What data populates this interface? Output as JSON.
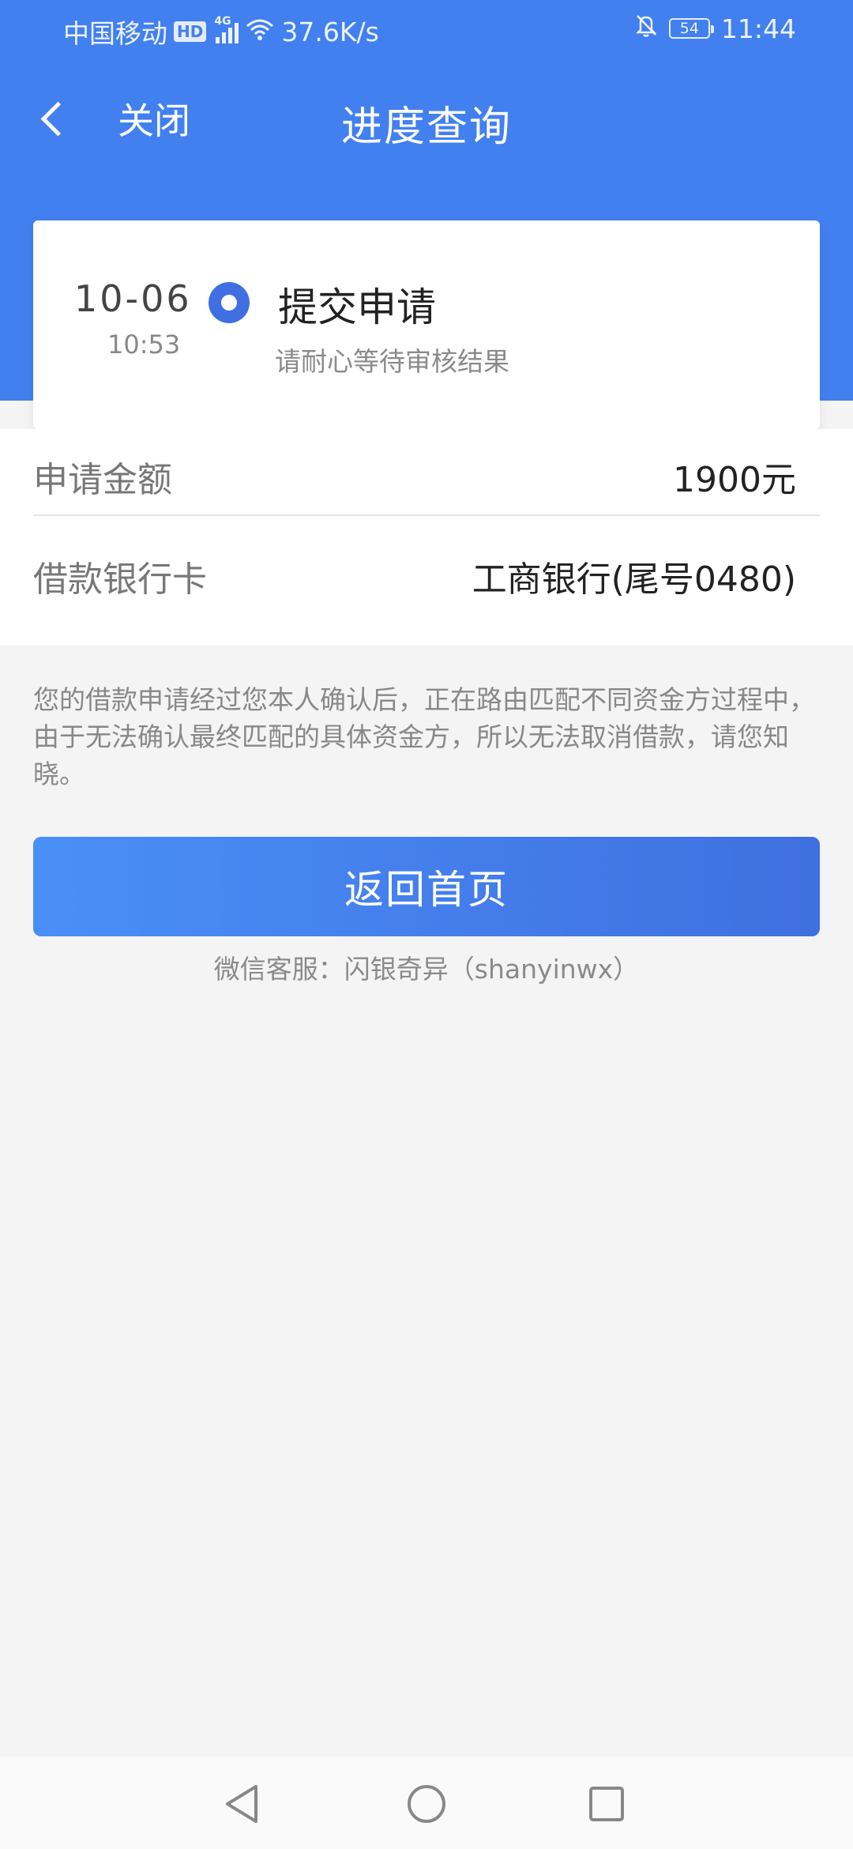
{
  "status_bar": {
    "carrier": "中国移动",
    "hd": "HD",
    "network": "4G",
    "speed": "37.6K/s",
    "battery": "54",
    "time": "11:44"
  },
  "nav": {
    "back_label": "关闭",
    "title": "进度查询"
  },
  "progress": {
    "date": "10-06",
    "time": "10:53",
    "status": "提交申请",
    "description": "请耐心等待审核结果"
  },
  "details": [
    {
      "label": "申请金额",
      "value": "1900元"
    },
    {
      "label": "借款银行卡",
      "value": "工商银行(尾号0480)"
    }
  ],
  "notice": "您的借款申请经过您本人确认后，正在路由匹配不同资金方过程中，由于无法确认最终匹配的具体资金方，所以无法取消借款，请您知晓。",
  "home_button": "返回首页",
  "wechat_service": "微信客服：闪银奇异（shanyinwx）",
  "colors": {
    "primary": "#4280f0",
    "accent": "#3f6fe0",
    "background": "#f4f4f4"
  }
}
